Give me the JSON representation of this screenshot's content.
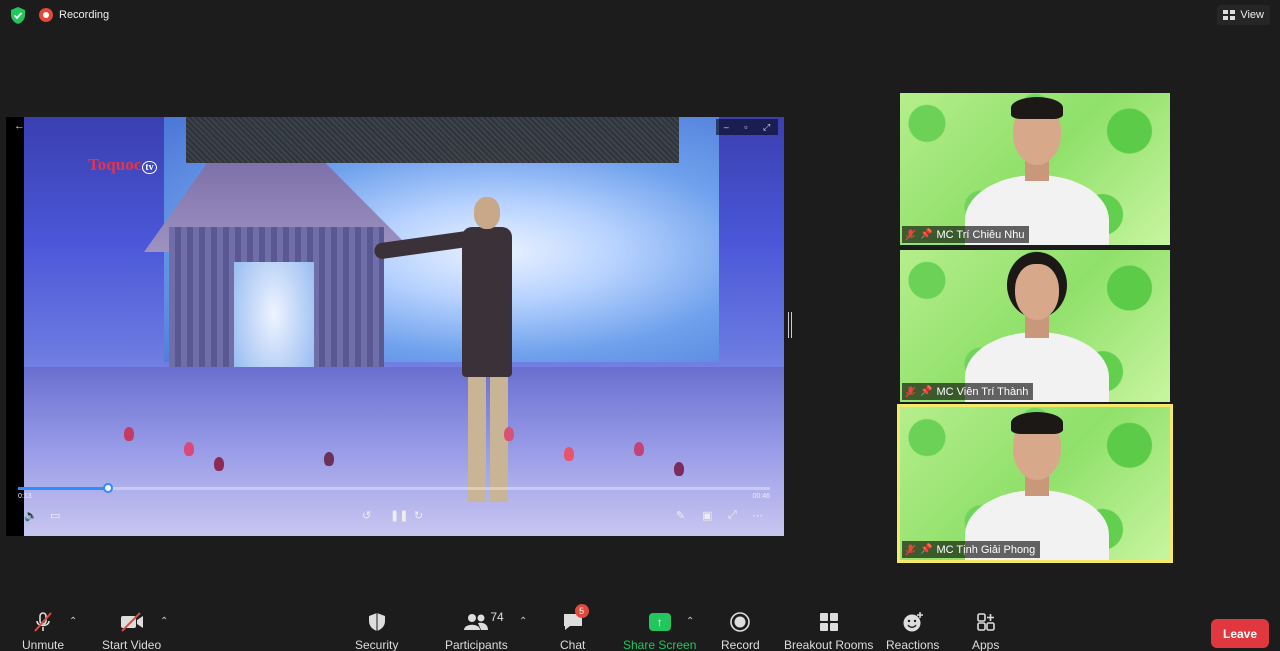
{
  "topbar": {
    "recording_label": "Recording",
    "view_label": "View"
  },
  "share": {
    "channel_logo": "Toquoc",
    "channel_logo_suffix": "tv",
    "time_elapsed": "0:13",
    "time_remaining": "00:46",
    "progress_fraction": 0.12
  },
  "participants": [
    {
      "name": "MC Trí Chiêu Nhu",
      "muted": true,
      "pinned": true,
      "active": false
    },
    {
      "name": "MC Viên Trí Thành",
      "muted": true,
      "pinned": true,
      "active": false
    },
    {
      "name": "MC Tịnh Giải Phong",
      "muted": true,
      "pinned": true,
      "active": true
    }
  ],
  "toolbar": {
    "unmute": "Unmute",
    "start_video": "Start Video",
    "security": "Security",
    "participants": "Participants",
    "participant_count": "74",
    "chat": "Chat",
    "chat_badge": "5",
    "share_screen": "Share Screen",
    "record": "Record",
    "breakout_rooms": "Breakout Rooms",
    "reactions": "Reactions",
    "apps": "Apps",
    "leave": "Leave"
  },
  "colors": {
    "background": "#1c1c1c",
    "leave_button": "#e0383e",
    "share_green": "#23c55e",
    "active_speaker_border": "#f4e96b",
    "recording_red": "#e3483c"
  }
}
